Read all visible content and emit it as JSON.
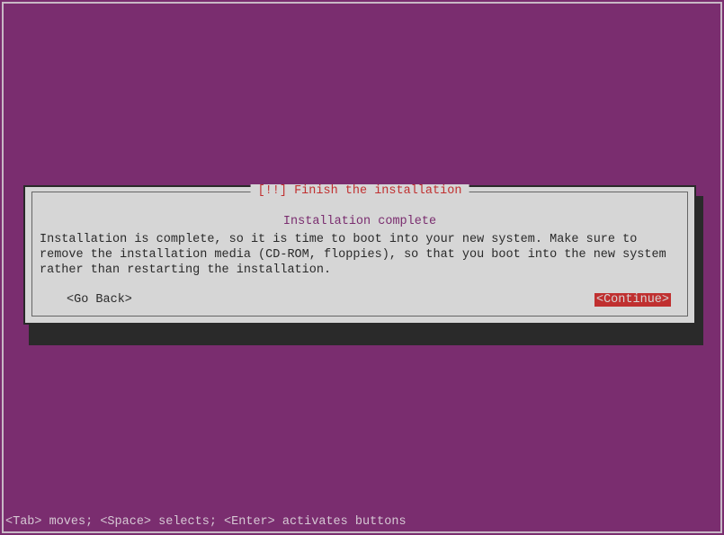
{
  "dialog": {
    "title": "[!!] Finish the installation",
    "subtitle": "Installation complete",
    "body": "Installation is complete, so it is time to boot into your new system. Make sure to remove the installation media (CD-ROM, floppies), so that you boot into the new system rather than restarting the installation.",
    "go_back_label": "<Go Back>",
    "continue_label": "<Continue>"
  },
  "help_bar": "<Tab> moves; <Space> selects; <Enter> activates buttons"
}
